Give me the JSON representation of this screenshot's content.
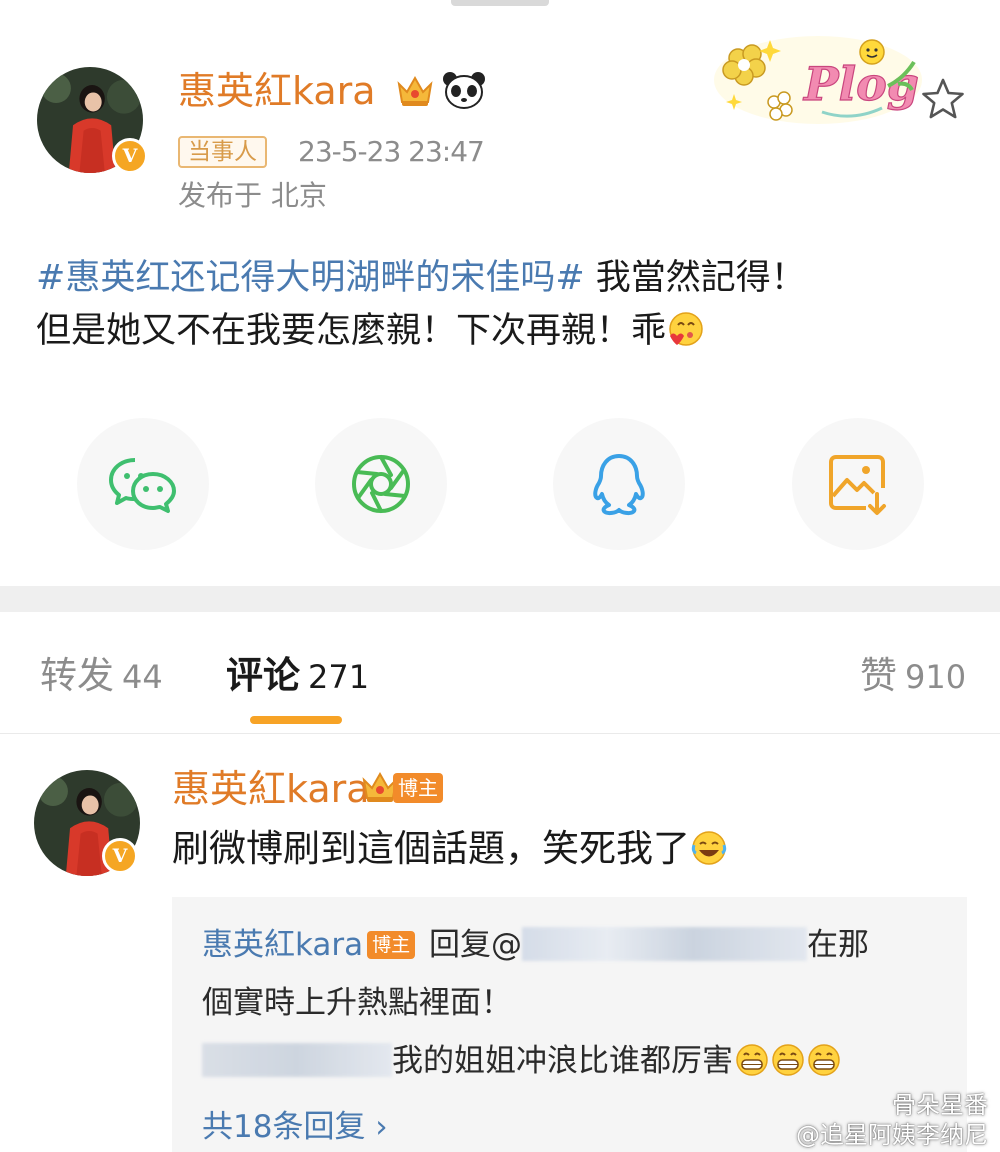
{
  "post": {
    "author": "惠英紅kara",
    "tag": "当事人",
    "time": "23-5-23 23:47",
    "location": "发布于 北京",
    "hashtag": "#惠英红还记得大明湖畔的宋佳吗#",
    "text_line1_rest": " 我當然記得！",
    "text_line2": "但是她又不在我要怎麼親！下次再親！乖",
    "decor_sticker": "Plog"
  },
  "share": [
    "wechat-icon",
    "moments-icon",
    "qq-icon",
    "save-image-icon"
  ],
  "tabs": {
    "repost_label": "转发",
    "repost_count": "44",
    "comment_label": "评论",
    "comment_count": "271",
    "like_label": "赞",
    "like_count": "910"
  },
  "comment": {
    "author": "惠英紅kara",
    "badge": "博主",
    "text": "刷微博刷到這個話題，笑死我了"
  },
  "reply": {
    "author": "惠英紅kara",
    "badge": "博主",
    "prefix": " 回复@",
    "line1_tail": "在那",
    "line2": "個實時上升熱點裡面！",
    "line3_text": "我的姐姐冲浪比谁都厉害",
    "more": "共18条回复 ›"
  },
  "watermark": {
    "line1": "骨朵星番",
    "line2": "@追星阿姨李纳尼"
  },
  "colors": {
    "username": "#e07b27",
    "link": "#4a7ab0",
    "accent": "#f7a326",
    "badge": "#f28b2a"
  }
}
